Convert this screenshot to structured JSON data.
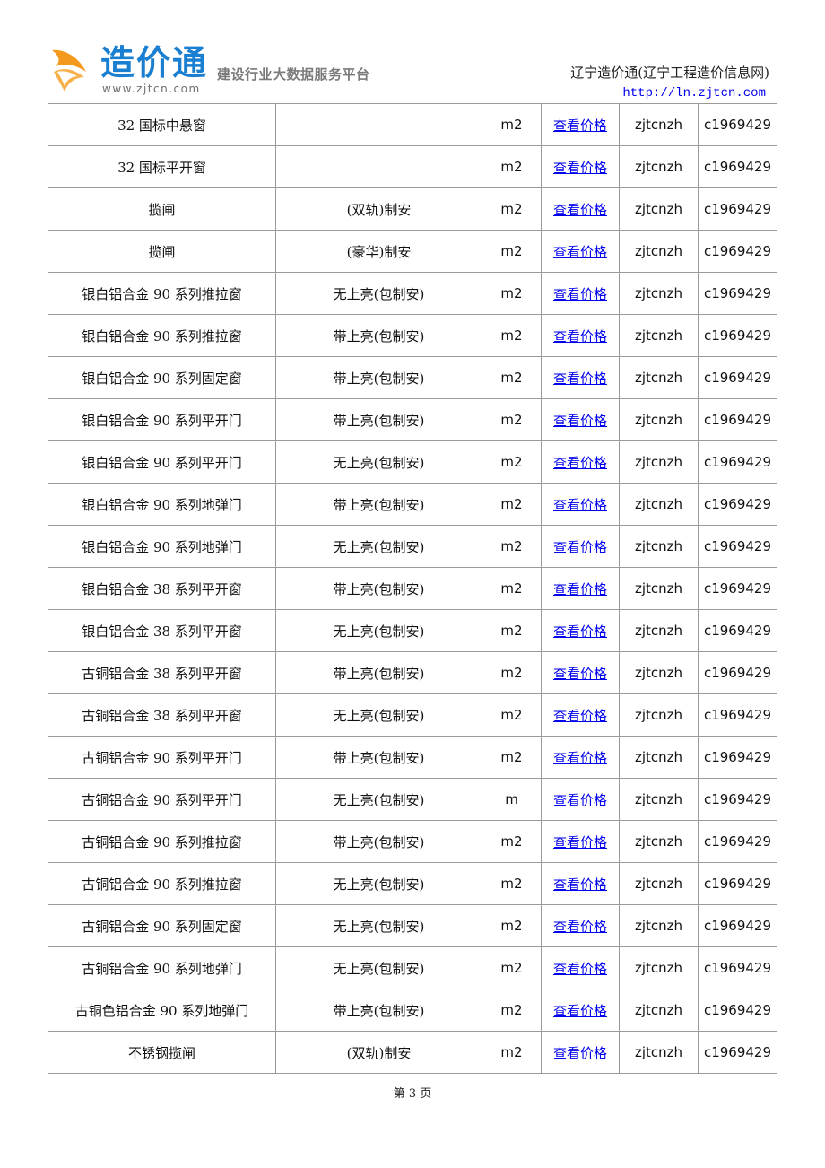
{
  "header": {
    "logo_name": "造价通",
    "logo_url": "www.zjtcn.com",
    "tagline": "建设行业大数据服务平台",
    "site_title": "辽宁造价通(辽宁工程造价信息网)",
    "site_url": "http://ln.zjtcn.com",
    "colors": {
      "logo_blue": "#1a7fd0",
      "logo_orange": "#f39a1e",
      "link": "#0000ee"
    }
  },
  "table": {
    "rows": [
      {
        "name": "32 国标中悬窗",
        "spec": "",
        "unit": "m2",
        "link": "查看价格",
        "user": "zjtcnzh",
        "code": "c1969429"
      },
      {
        "name": "32 国标平开窗",
        "spec": "",
        "unit": "m2",
        "link": "查看价格",
        "user": "zjtcnzh",
        "code": "c1969429"
      },
      {
        "name": "揽闸",
        "spec": "(双轨)制安",
        "unit": "m2",
        "link": "查看价格",
        "user": "zjtcnzh",
        "code": "c1969429"
      },
      {
        "name": "揽闸",
        "spec": "(豪华)制安",
        "unit": "m2",
        "link": "查看价格",
        "user": "zjtcnzh",
        "code": "c1969429"
      },
      {
        "name": "银白铝合金 90 系列推拉窗",
        "spec": "无上亮(包制安)",
        "unit": "m2",
        "link": "查看价格",
        "user": "zjtcnzh",
        "code": "c1969429"
      },
      {
        "name": "银白铝合金 90 系列推拉窗",
        "spec": "带上亮(包制安)",
        "unit": "m2",
        "link": "查看价格",
        "user": "zjtcnzh",
        "code": "c1969429"
      },
      {
        "name": "银白铝合金 90 系列固定窗",
        "spec": "带上亮(包制安)",
        "unit": "m2",
        "link": "查看价格",
        "user": "zjtcnzh",
        "code": "c1969429"
      },
      {
        "name": "银白铝合金 90 系列平开门",
        "spec": "带上亮(包制安)",
        "unit": "m2",
        "link": "查看价格",
        "user": "zjtcnzh",
        "code": "c1969429"
      },
      {
        "name": "银白铝合金 90 系列平开门",
        "spec": "无上亮(包制安)",
        "unit": "m2",
        "link": "查看价格",
        "user": "zjtcnzh",
        "code": "c1969429"
      },
      {
        "name": "银白铝合金 90 系列地弹门",
        "spec": "带上亮(包制安)",
        "unit": "m2",
        "link": "查看价格",
        "user": "zjtcnzh",
        "code": "c1969429"
      },
      {
        "name": "银白铝合金 90 系列地弹门",
        "spec": "无上亮(包制安)",
        "unit": "m2",
        "link": "查看价格",
        "user": "zjtcnzh",
        "code": "c1969429"
      },
      {
        "name": "银白铝合金 38 系列平开窗",
        "spec": "带上亮(包制安)",
        "unit": "m2",
        "link": "查看价格",
        "user": "zjtcnzh",
        "code": "c1969429"
      },
      {
        "name": "银白铝合金 38 系列平开窗",
        "spec": "无上亮(包制安)",
        "unit": "m2",
        "link": "查看价格",
        "user": "zjtcnzh",
        "code": "c1969429"
      },
      {
        "name": "古铜铝合金 38 系列平开窗",
        "spec": "带上亮(包制安)",
        "unit": "m2",
        "link": "查看价格",
        "user": "zjtcnzh",
        "code": "c1969429"
      },
      {
        "name": "古铜铝合金 38 系列平开窗",
        "spec": "无上亮(包制安)",
        "unit": "m2",
        "link": "查看价格",
        "user": "zjtcnzh",
        "code": "c1969429"
      },
      {
        "name": "古铜铝合金 90 系列平开门",
        "spec": "带上亮(包制安)",
        "unit": "m2",
        "link": "查看价格",
        "user": "zjtcnzh",
        "code": "c1969429"
      },
      {
        "name": "古铜铝合金 90 系列平开门",
        "spec": "无上亮(包制安)",
        "unit": "m",
        "link": "查看价格",
        "user": "zjtcnzh",
        "code": "c1969429"
      },
      {
        "name": "古铜铝合金 90 系列推拉窗",
        "spec": "带上亮(包制安)",
        "unit": "m2",
        "link": "查看价格",
        "user": "zjtcnzh",
        "code": "c1969429"
      },
      {
        "name": "古铜铝合金 90 系列推拉窗",
        "spec": "无上亮(包制安)",
        "unit": "m2",
        "link": "查看价格",
        "user": "zjtcnzh",
        "code": "c1969429"
      },
      {
        "name": "古铜铝合金 90 系列固定窗",
        "spec": "无上亮(包制安)",
        "unit": "m2",
        "link": "查看价格",
        "user": "zjtcnzh",
        "code": "c1969429"
      },
      {
        "name": "古铜铝合金 90 系列地弹门",
        "spec": "无上亮(包制安)",
        "unit": "m2",
        "link": "查看价格",
        "user": "zjtcnzh",
        "code": "c1969429"
      },
      {
        "name": "古铜色铝合金 90 系列地弹门",
        "spec": "带上亮(包制安)",
        "unit": "m2",
        "link": "查看价格",
        "user": "zjtcnzh",
        "code": "c1969429"
      },
      {
        "name": "不锈钢揽闸",
        "spec": "(双轨)制安",
        "unit": "m2",
        "link": "查看价格",
        "user": "zjtcnzh",
        "code": "c1969429"
      }
    ]
  },
  "footer": {
    "page_label": "第 3 页"
  }
}
